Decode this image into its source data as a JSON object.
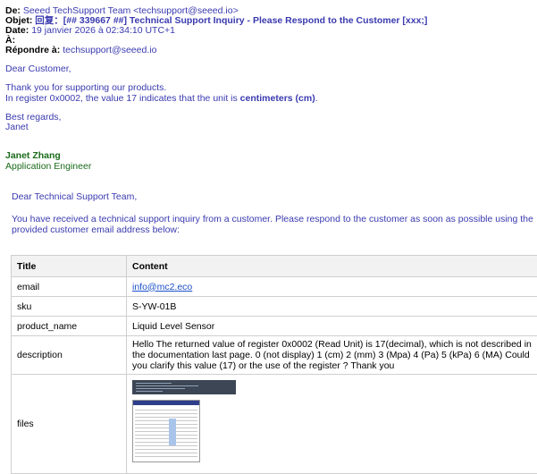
{
  "header": {
    "from_label": "De:",
    "from_value": "Seeed TechSupport Team <techsupport@seeed.io>",
    "subject_label": "Objet:",
    "subject_value": "回复：[## 339667 ##] Technical Support Inquiry - Please Respond to the Customer [xxx;]",
    "date_label": "Date:",
    "date_value": "19 janvier 2026 à 02:34:10 UTC+1",
    "to_label": "À:",
    "reply_label": "Répondre à:",
    "reply_value": "techsupport@seeed.io"
  },
  "reply": {
    "greeting": "Dear Customer,",
    "line1": "Thank you for supporting our products.",
    "line2_prefix": "In register 0x0002, the value 17 indicates that the unit is ",
    "line2_bold": "centimeters (cm)",
    "line2_suffix": ".",
    "regards": "Best regards,",
    "regards_name": "Janet",
    "sig_name": "Janet Zhang",
    "sig_title": "Application Engineer"
  },
  "inquiry": {
    "greeting": "Dear Technical Support Team,",
    "intro": "You have received a technical support inquiry from a customer. Please respond to the customer as soon as possible using the provided customer email address below:"
  },
  "table": {
    "col_title": "Title",
    "col_content": "Content",
    "rows": [
      {
        "key": "email",
        "value": "info@mc2.eco"
      },
      {
        "key": "sku",
        "value": "S-YW-01B"
      },
      {
        "key": "product_name",
        "value": "Liquid Level Sensor"
      },
      {
        "key": "description",
        "value": "Hello The returned value of register 0x0002 (Read Unit) is 17(decimal), which is not described in the documentation last page. 0 (not display) 1 (cm) 2 (mm) 3 (Mpa) 4 (Pa) 5 (kPa) 6 (MA) Could you clarify this value (17) or the use of the register ? Thank you"
      },
      {
        "key": "files",
        "value": ""
      }
    ]
  }
}
